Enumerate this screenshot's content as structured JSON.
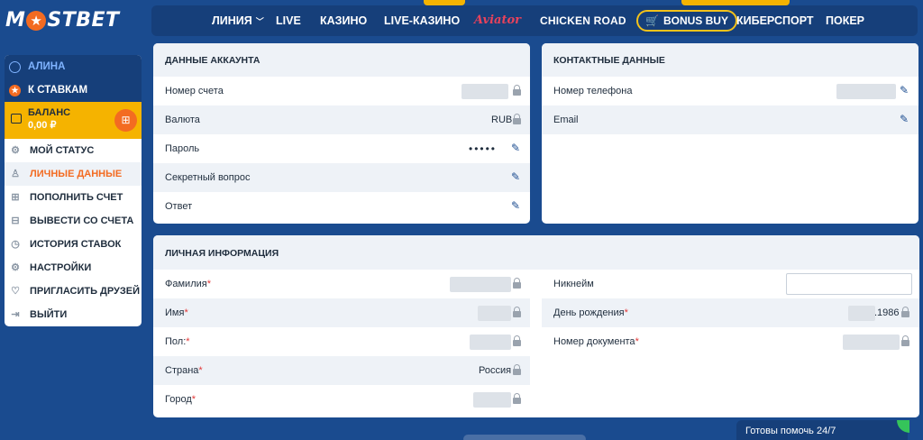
{
  "brand": {
    "logo_left": "M",
    "logo_right": "STBET",
    "accent": "#f36b21",
    "primary": "#1a4b8f",
    "bonus_outline": "#f4c21a"
  },
  "nav": {
    "items": [
      {
        "label": "ЛИНИЯ",
        "has_chevron": true
      },
      {
        "label": "LIVE"
      },
      {
        "label": "КАЗИНО"
      },
      {
        "label": "LIVE-КАЗИНО"
      },
      {
        "label": "Aviator"
      },
      {
        "label": "CHICKEN ROAD"
      },
      {
        "label": "BONUS BUY"
      },
      {
        "label": "КИБЕРСПОРТ"
      },
      {
        "label": "ПОКЕР"
      }
    ]
  },
  "sidebar": {
    "user_name": "АЛИНА",
    "to_bets": "К СТАВКАМ",
    "balance_label": "БАЛАНС",
    "balance_value": "0,00 ₽",
    "items": [
      {
        "label": "МОЙ СТАТУС",
        "icon": "gear-icon"
      },
      {
        "label": "ЛИЧНЫЕ ДАННЫЕ",
        "icon": "user-icon",
        "active": true
      },
      {
        "label": "ПОПОЛНИТЬ СЧЕТ",
        "icon": "deposit-icon"
      },
      {
        "label": "ВЫВЕСТИ СО СЧЕТА",
        "icon": "withdraw-icon"
      },
      {
        "label": "ИСТОРИЯ СТАВОК",
        "icon": "clock-icon"
      },
      {
        "label": "НАСТРОЙКИ",
        "icon": "settings-icon"
      },
      {
        "label": "ПРИГЛАСИТЬ ДРУЗЕЙ",
        "icon": "handshake-icon"
      },
      {
        "label": "ВЫЙТИ",
        "icon": "logout-icon"
      }
    ]
  },
  "account": {
    "title": "ДАННЫЕ АККАУНТА",
    "rows": [
      {
        "label": "Номер счета",
        "value_hidden": true,
        "action": "lock"
      },
      {
        "label": "Валюта",
        "value": "RUB",
        "action": "lock"
      },
      {
        "label": "Пароль",
        "value": "•••••",
        "action": "edit"
      },
      {
        "label": "Секретный вопрос",
        "action": "edit"
      },
      {
        "label": "Ответ",
        "action": "edit"
      }
    ]
  },
  "contacts": {
    "title": "КОНТАКТНЫЕ ДАННЫЕ",
    "rows": [
      {
        "label": "Номер телефона",
        "value_hidden": true,
        "action": "edit"
      },
      {
        "label": "Email",
        "action": "edit"
      }
    ]
  },
  "personal": {
    "title": "ЛИЧНАЯ ИНФОРМАЦИЯ",
    "left_rows": [
      {
        "label": "Фамилия",
        "required": "*"
      },
      {
        "label": "Имя",
        "required": "*"
      },
      {
        "label": "Пол:",
        "required": "*"
      },
      {
        "label": "Страна",
        "required": "*",
        "value": "Россия"
      },
      {
        "label": "Город",
        "required": "*"
      }
    ],
    "right_rows": [
      {
        "label": "Никнейм",
        "input": true
      },
      {
        "label": "День рождения",
        "required": "*",
        "value_suffix": ".1986"
      },
      {
        "label": "Номер документа",
        "required": "*"
      }
    ]
  },
  "chat": {
    "label": "Готовы помочь 24/7"
  }
}
